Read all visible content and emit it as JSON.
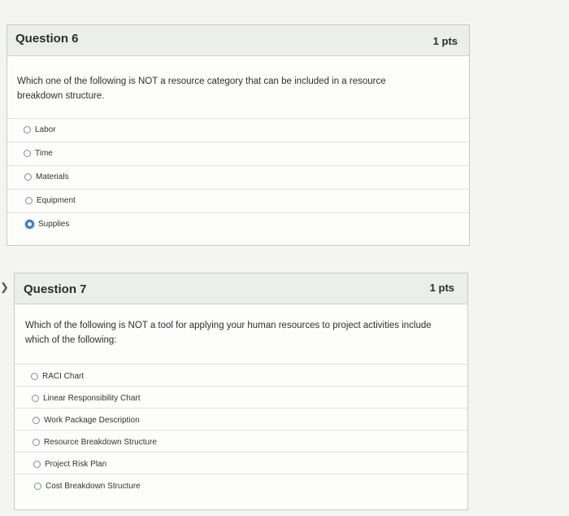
{
  "question6": {
    "title": "Question 6",
    "points": "1 pts",
    "text": "Which one of the following is NOT a resource category that can be included in a resource breakdown structure.",
    "answers": [
      "Labor",
      "Time",
      "Materials",
      "Equipment",
      "Supplies"
    ],
    "selected": "Supplies"
  },
  "question7": {
    "title": "Question 7",
    "points": "1 pts",
    "text": "Which of the following is NOT a tool for applying your human resources to project activities include which of the following:",
    "answers": [
      "RACI Chart",
      "Linear Responsibility Chart",
      "Work Package Description",
      "Resource Breakdown Structure",
      "Project Risk Plan",
      "Cost Breakdown Structure"
    ],
    "selected": null
  },
  "nav": {
    "arrow_icon": "chevron-right-icon"
  },
  "colors": {
    "accent": "#3d7cbe",
    "header_bg": "#eceeeb",
    "border": "#c9cac6"
  }
}
